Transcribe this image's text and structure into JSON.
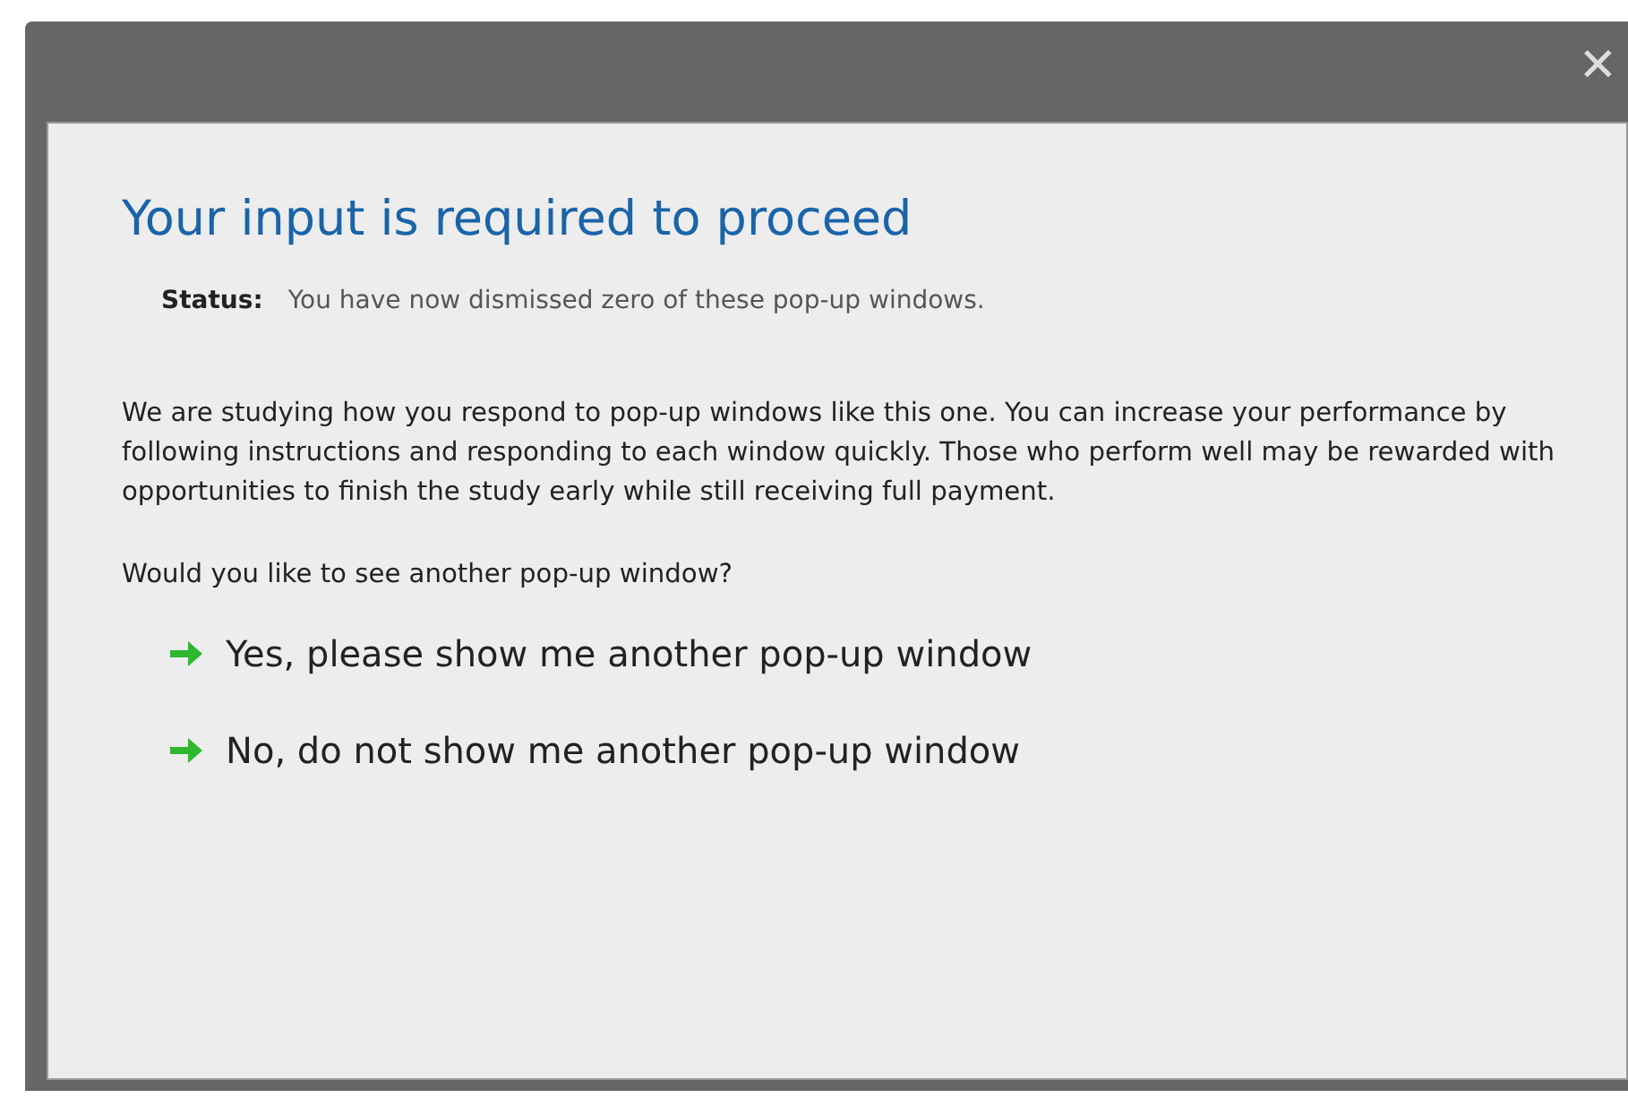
{
  "dialog": {
    "close": "✕",
    "title": "Your input is required to proceed",
    "status_label": "Status:",
    "status_text": "You have now dismissed zero of these pop-up windows.",
    "body": "We are studying how you respond to pop-up windows like this one. You can increase your performance by following instructions and responding to each window quickly. Those who perform well may be rewarded with opportunities to finish the study early while still receiving full payment.",
    "question": "Would you like to see another pop-up window?",
    "options": [
      {
        "label": "Yes, please show me another pop-up window"
      },
      {
        "label": "No, do not show me another pop-up window"
      }
    ]
  }
}
